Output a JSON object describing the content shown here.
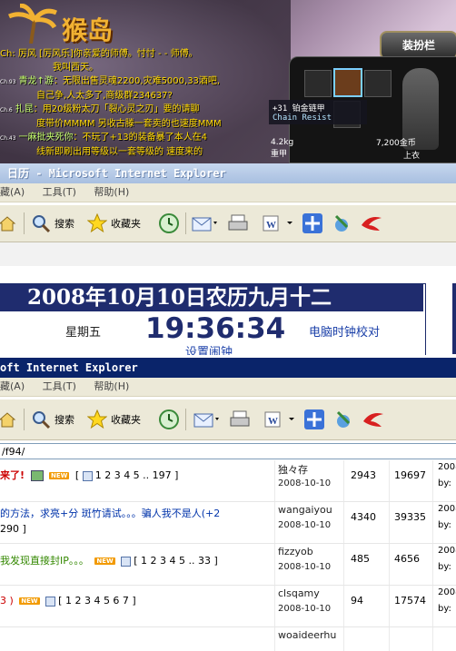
{
  "game": {
    "logo_text": "猴岛",
    "chat_lines": [
      {
        "ch": "",
        "name": "",
        "text": "Ch: 厉风 [厉风乐]你亲爱的师傅。忖忖 - - 师傅。"
      },
      {
        "ch": "",
        "name": "",
        "text": "我叫西天。"
      },
      {
        "ch": "Ch.93",
        "name": "青龙↑游",
        "text": "：无限出售灵魂2200,灾难5000,33酒吧,"
      },
      {
        "ch": "",
        "name": "",
        "text": "自己争,人太多了,商级群234637?"
      },
      {
        "ch": "Ch.6",
        "name": "扎昆",
        "text": "：用20级粉太刀「裂心灵之刃」要的请聊"
      },
      {
        "ch": "",
        "name": "",
        "text": "度带价MMMM 另收古滕一套卖的也速度MMM"
      },
      {
        "ch": "Ch.43",
        "name": "一麻批夹死你",
        "text": "：不玩了+13的装备暴了本人在4"
      },
      {
        "ch": "",
        "name": "",
        "text": "线新即刷出用等级以一套等级的 速度来的"
      }
    ],
    "equipment_title": "装扮栏",
    "tooltip_name": "+31 铂金链甲",
    "tooltip_sub": "Chain Resist",
    "weight": "4.2kg",
    "weight_label": "重甲",
    "gold": "7,200金币",
    "gold_label": "上衣"
  },
  "window1": {
    "title": "日历 - Microsoft Internet Explorer",
    "menu": [
      "藏(A)",
      "工具(T)",
      "帮助(H)"
    ],
    "toolbar": {
      "search": "搜索",
      "favorites": "收藏夹"
    },
    "calendar": {
      "date_heading": "2008年10月10日农历九月十二",
      "weekday": "星期五",
      "time": "19:36:34",
      "sync_link": "电脑时钟校对",
      "alarm_link": "设置闹钟"
    }
  },
  "window2": {
    "title": "oft Internet Explorer",
    "menu": [
      "藏(A)",
      "工具(T)",
      "帮助(H)"
    ],
    "toolbar": {
      "search": "搜索",
      "favorites": "收藏夹"
    },
    "address": "/f94/"
  },
  "forum": {
    "rows": [
      {
        "title": "来了!",
        "pages": "1 2 3 4 5 .. 197 ]",
        "title_color": "#cc0000",
        "author": "独々存",
        "date": "2008-10-10",
        "replies": "2943",
        "views": "19697",
        "last1": "2008",
        "last2": "by:"
      },
      {
        "title": "的方法，求亮+分 斑竹请试。。。骗人我不是人(+2",
        "pages": "290 ]",
        "title_color": "#0033aa",
        "author": "wangaiyou",
        "date": "2008-10-10",
        "replies": "4340",
        "views": "39335",
        "last1": "2008",
        "last2": "by:"
      },
      {
        "title": "我发现直接封IP。。。",
        "pages": "[ 1 2 3 4 5 .. 33 ]",
        "title_color": "#338800",
        "author": "fizzyob",
        "date": "2008-10-10",
        "replies": "485",
        "views": "4656",
        "last1": "2008",
        "last2": "by:"
      },
      {
        "title": "3 )",
        "pages": "[ 1 2 3 4 5 6 7 ]",
        "title_color": "#cc0000",
        "author": "clsqamy",
        "date": "2008-10-10",
        "replies": "94",
        "views": "17574",
        "last1": "2008",
        "last2": "by:"
      },
      {
        "title": "",
        "pages": "",
        "title_color": "#000000",
        "author": "woaideerhu",
        "date": "",
        "replies": "",
        "views": "",
        "last1": "",
        "last2": ""
      }
    ]
  }
}
